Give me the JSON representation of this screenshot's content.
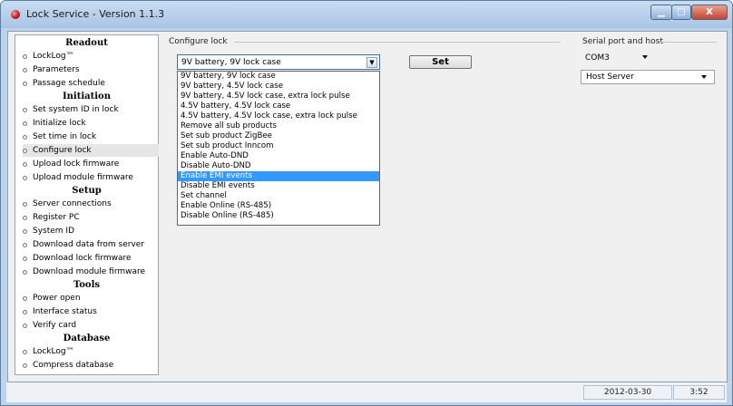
{
  "window": {
    "title": "Lock Service - Version 1.1.3",
    "min_symbol": "▁",
    "max_symbol": "□",
    "close_symbol": "X"
  },
  "sidebar": {
    "sections": [
      {
        "header": "Readout",
        "items": [
          "LockLog™",
          "Parameters",
          "Passage schedule"
        ]
      },
      {
        "header": "Initiation",
        "items": [
          "Set system ID in lock",
          "Initialize lock",
          "Set time in lock",
          "Configure lock",
          "Upload lock firmware",
          "Upload module firmware"
        ]
      },
      {
        "header": "Setup",
        "items": [
          "Server connections",
          "Register PC",
          "System ID",
          "Download data from server",
          "Download lock firmware",
          "Download module firmware"
        ]
      },
      {
        "header": "Tools",
        "items": [
          "Power open",
          "Interface status",
          "Verify card"
        ]
      },
      {
        "header": "Database",
        "items": [
          "LockLog™",
          "Compress database"
        ]
      }
    ],
    "selected": "Configure lock"
  },
  "configure": {
    "group_label": "Configure lock",
    "selected_value": "9V battery, 9V lock case",
    "options": [
      "9V battery, 9V lock case",
      "9V battery, 4.5V lock case",
      "9V battery, 4.5V lock case, extra lock pulse",
      "4.5V battery, 4.5V lock case",
      "4.5V battery, 4.5V lock case, extra lock pulse",
      "Remove all sub products",
      "Set sub product ZigBee",
      "Set sub product Inncom",
      "Enable Auto-DND",
      "Disable Auto-DND",
      "Enable EMI events",
      "Disable EMI events",
      "Set channel",
      "Enable Online (RS-485)",
      "Disable Online (RS-485)"
    ],
    "highlighted": "Enable EMI events",
    "set_label": "Set"
  },
  "serial": {
    "group_label": "Serial port and host",
    "port": "COM3",
    "host": "Host Server"
  },
  "status": {
    "date": "2012-03-30",
    "time": "3:52"
  },
  "colors": {
    "highlight": "#3399ff",
    "frame": "#bcd3ec"
  }
}
